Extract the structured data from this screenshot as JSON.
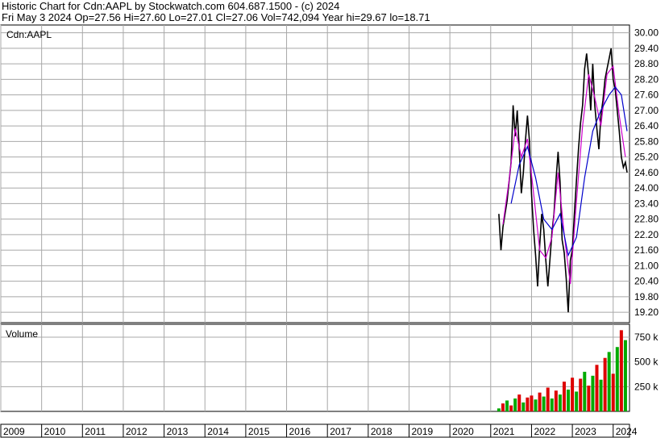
{
  "header": {
    "line1": "Historic Chart for Cdn:AAPL by Stockwatch.com 604.687.1500 - (c) 2024",
    "line2": "Fri May  3 2024   Op=27.56   Hi=27.60   Lo=27.01   Cl=27.06   Vol=742,094   Year hi=29.67   lo=18.71"
  },
  "colors": {
    "price": "#000000",
    "ma_short": "#cc00cc",
    "ma_long": "#0000cc",
    "vol_up": "#00aa00",
    "vol_down": "#dd0000",
    "grid": "#a8a8a8"
  },
  "chart_data": [
    {
      "type": "line",
      "symbol_label": "Cdn:AAPL",
      "ylim": [
        18.8,
        30.3
      ],
      "y_ticks": [
        "30.00",
        "29.40",
        "28.80",
        "28.20",
        "27.60",
        "27.00",
        "26.40",
        "25.80",
        "25.20",
        "24.60",
        "24.00",
        "23.40",
        "22.80",
        "22.20",
        "21.60",
        "21.00",
        "20.40",
        "19.80",
        "19.20"
      ],
      "xlim": [
        2009.0,
        2024.4
      ],
      "x_ticks": [
        "2009",
        "2010",
        "2011",
        "2012",
        "2013",
        "2014",
        "2015",
        "2016",
        "2017",
        "2018",
        "2019",
        "2020",
        "2021",
        "2022",
        "2023",
        "2024"
      ],
      "series": [
        {
          "role": "close",
          "x": [
            2021.2,
            2021.25,
            2021.3,
            2021.4,
            2021.5,
            2021.55,
            2021.6,
            2021.65,
            2021.7,
            2021.75,
            2021.8,
            2021.85,
            2021.9,
            2021.95,
            2022.0,
            2022.05,
            2022.1,
            2022.15,
            2022.2,
            2022.25,
            2022.3,
            2022.35,
            2022.4,
            2022.45,
            2022.5,
            2022.55,
            2022.6,
            2022.65,
            2022.7,
            2022.75,
            2022.8,
            2022.85,
            2022.9,
            2022.95,
            2023.0,
            2023.05,
            2023.1,
            2023.15,
            2023.2,
            2023.25,
            2023.3,
            2023.35,
            2023.4,
            2023.45,
            2023.5,
            2023.55,
            2023.6,
            2023.65,
            2023.7,
            2023.75,
            2023.8,
            2023.85,
            2023.9,
            2023.95,
            2024.0,
            2024.05,
            2024.1,
            2024.15,
            2024.2,
            2024.25,
            2024.3,
            2024.34
          ],
          "y": [
            23.0,
            21.6,
            22.5,
            23.5,
            25.0,
            27.2,
            26.0,
            27.0,
            25.5,
            23.8,
            24.6,
            25.8,
            26.8,
            25.8,
            23.8,
            22.4,
            21.4,
            20.2,
            21.8,
            23.0,
            22.4,
            21.2,
            20.2,
            21.2,
            22.3,
            23.0,
            24.3,
            25.4,
            24.2,
            22.0,
            21.5,
            20.5,
            19.2,
            21.2,
            21.6,
            23.0,
            24.3,
            25.5,
            26.5,
            27.2,
            28.6,
            29.2,
            28.3,
            27.0,
            28.8,
            27.2,
            26.3,
            25.5,
            26.8,
            27.4,
            28.2,
            28.6,
            29.0,
            29.4,
            28.2,
            27.8,
            27.0,
            26.2,
            25.2,
            24.8,
            25.0,
            24.6
          ]
        },
        {
          "role": "moving_average_short",
          "x": [
            2021.3,
            2021.45,
            2021.6,
            2021.75,
            2021.9,
            2022.05,
            2022.2,
            2022.35,
            2022.5,
            2022.65,
            2022.8,
            2022.95,
            2023.1,
            2023.25,
            2023.4,
            2023.55,
            2023.7,
            2023.85,
            2024.0,
            2024.15,
            2024.3
          ],
          "y": [
            22.6,
            24.3,
            26.3,
            25.2,
            25.9,
            23.8,
            21.6,
            21.3,
            22.1,
            24.6,
            22.2,
            20.3,
            23.5,
            26.4,
            28.4,
            27.5,
            26.4,
            28.4,
            28.7,
            26.8,
            25.2
          ]
        },
        {
          "role": "moving_average_long",
          "x": [
            2021.5,
            2021.7,
            2021.9,
            2022.1,
            2022.3,
            2022.5,
            2022.7,
            2022.9,
            2023.1,
            2023.3,
            2023.5,
            2023.7,
            2023.9,
            2024.05,
            2024.2,
            2024.34
          ],
          "y": [
            23.4,
            24.9,
            25.6,
            24.4,
            22.8,
            22.4,
            23.0,
            21.4,
            22.1,
            24.4,
            26.2,
            27.0,
            27.6,
            27.9,
            27.6,
            26.2
          ]
        }
      ]
    },
    {
      "type": "bar",
      "title": "Volume",
      "ylim": [
        0,
        880000
      ],
      "y_ticks": [
        "750 k",
        "500 k",
        "250 k"
      ],
      "y_tick_values": [
        750000,
        500000,
        250000
      ],
      "x": [
        2021.2,
        2021.3,
        2021.4,
        2021.5,
        2021.6,
        2021.7,
        2021.8,
        2021.9,
        2022.0,
        2022.1,
        2022.2,
        2022.3,
        2022.4,
        2022.5,
        2022.6,
        2022.7,
        2022.8,
        2022.9,
        2023.0,
        2023.1,
        2023.2,
        2023.3,
        2023.4,
        2023.5,
        2023.6,
        2023.7,
        2023.8,
        2023.9,
        2024.0,
        2024.1,
        2024.2,
        2024.3
      ],
      "values": [
        30000,
        80000,
        110000,
        60000,
        130000,
        170000,
        90000,
        140000,
        160000,
        120000,
        190000,
        150000,
        240000,
        130000,
        210000,
        170000,
        300000,
        220000,
        340000,
        200000,
        330000,
        400000,
        260000,
        360000,
        470000,
        320000,
        540000,
        600000,
        380000,
        650000,
        820000,
        720000
      ],
      "direction": [
        "up",
        "down",
        "up",
        "down",
        "up",
        "down",
        "up",
        "down",
        "down",
        "up",
        "down",
        "up",
        "down",
        "up",
        "down",
        "up",
        "down",
        "up",
        "down",
        "up",
        "down",
        "up",
        "down",
        "up",
        "down",
        "up",
        "down",
        "up",
        "down",
        "up",
        "down",
        "up"
      ]
    }
  ]
}
